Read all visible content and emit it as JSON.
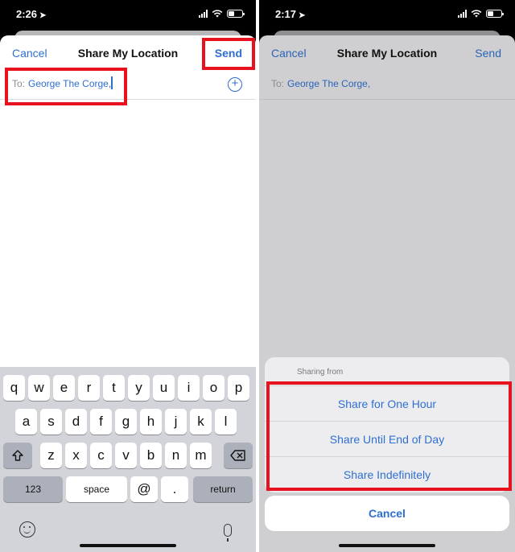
{
  "left": {
    "status": {
      "time": "2:26"
    },
    "nav": {
      "cancel": "Cancel",
      "title": "Share My Location",
      "send": "Send"
    },
    "to": {
      "label": "To:",
      "value": "George The Corge,"
    },
    "keyboard": {
      "row1": [
        "q",
        "w",
        "e",
        "r",
        "t",
        "y",
        "u",
        "i",
        "o",
        "p"
      ],
      "row2": [
        "a",
        "s",
        "d",
        "f",
        "g",
        "h",
        "j",
        "k",
        "l"
      ],
      "row3": [
        "z",
        "x",
        "c",
        "v",
        "b",
        "n",
        "m"
      ],
      "numbers": "123",
      "space": "space",
      "at": "@",
      "dot": ".",
      "return": "return"
    }
  },
  "right": {
    "status": {
      "time": "2:17"
    },
    "nav": {
      "cancel": "Cancel",
      "title": "Share My Location",
      "send": "Send"
    },
    "to": {
      "label": "To:",
      "value": "George The Corge,"
    },
    "action_sheet": {
      "title": "Sharing from",
      "options": [
        "Share for One Hour",
        "Share Until End of Day",
        "Share Indefinitely"
      ],
      "cancel": "Cancel"
    }
  },
  "colors": {
    "accent": "#2f6fd1",
    "highlight": "#e8121e"
  }
}
